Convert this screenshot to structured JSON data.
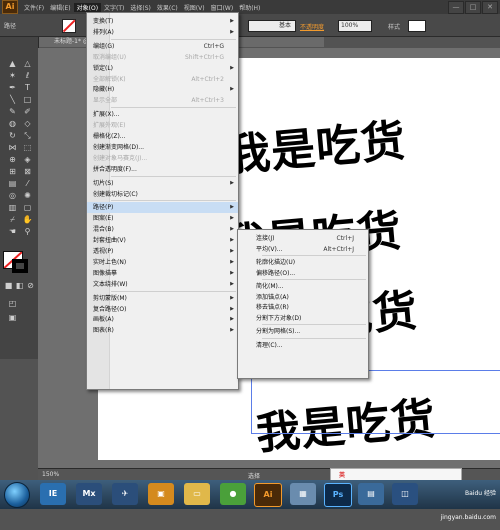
{
  "app": {
    "logo": "Ai"
  },
  "menubar": {
    "items": [
      "文件(F)",
      "编辑(E)",
      "对象(O)",
      "文字(T)",
      "选择(S)",
      "效果(C)",
      "视图(V)",
      "窗口(W)",
      "帮助(H)"
    ],
    "active_index": 2
  },
  "window_controls": [
    "—",
    "□",
    "✕"
  ],
  "controlbar": {
    "left_label": "路径",
    "stroke_style": "基本",
    "style_label": "不透明度",
    "opacity": "100%",
    "style_text": "样式"
  },
  "doc_tab": {
    "title": "未标题-1* @ 150% (RGB/预览)"
  },
  "artwork": {
    "lines": [
      "我是吃货",
      "我是吃货",
      "我是吃货",
      "我是吃货"
    ]
  },
  "object_menu": {
    "items": [
      {
        "label": "变换(T)",
        "submenu": true
      },
      {
        "label": "排列(A)",
        "submenu": true
      },
      {
        "sep": true
      },
      {
        "label": "编组(G)",
        "shortcut": "Ctrl+G"
      },
      {
        "label": "取消编组(U)",
        "shortcut": "Shift+Ctrl+G",
        "disabled": true
      },
      {
        "label": "锁定(L)",
        "submenu": true
      },
      {
        "label": "全部解锁(K)",
        "shortcut": "Alt+Ctrl+2",
        "disabled": true
      },
      {
        "label": "隐藏(H)",
        "submenu": true
      },
      {
        "label": "显示全部",
        "shortcut": "Alt+Ctrl+3",
        "disabled": true
      },
      {
        "sep": true
      },
      {
        "label": "扩展(X)..."
      },
      {
        "label": "扩展外观(E)",
        "disabled": true
      },
      {
        "label": "栅格化(Z)..."
      },
      {
        "label": "创建渐变网格(D)..."
      },
      {
        "label": "创建对象马赛克(J)...",
        "disabled": true
      },
      {
        "label": "拼合透明度(F)..."
      },
      {
        "sep": true
      },
      {
        "label": "切片(S)",
        "submenu": true
      },
      {
        "label": "创建裁切标记(C)"
      },
      {
        "sep": true
      },
      {
        "label": "路径(P)",
        "submenu": true,
        "highlighted": true
      },
      {
        "label": "图案(E)",
        "submenu": true
      },
      {
        "label": "混合(B)",
        "submenu": true
      },
      {
        "label": "封套扭曲(V)",
        "submenu": true
      },
      {
        "label": "透视(P)",
        "submenu": true
      },
      {
        "label": "实时上色(N)",
        "submenu": true
      },
      {
        "label": "图像描摹",
        "submenu": true
      },
      {
        "label": "文本绕排(W)",
        "submenu": true
      },
      {
        "sep": true
      },
      {
        "label": "剪切蒙版(M)",
        "submenu": true
      },
      {
        "label": "复合路径(O)",
        "submenu": true
      },
      {
        "label": "画板(A)",
        "submenu": true
      },
      {
        "label": "图表(R)",
        "submenu": true
      }
    ]
  },
  "path_menu": {
    "items": [
      {
        "label": "连接(J)",
        "shortcut": "Ctrl+J"
      },
      {
        "label": "平均(V)...",
        "shortcut": "Alt+Ctrl+J"
      },
      {
        "sep": true
      },
      {
        "label": "轮廓化描边(U)"
      },
      {
        "label": "偏移路径(O)..."
      },
      {
        "sep": true
      },
      {
        "label": "简化(M)..."
      },
      {
        "label": "添加锚点(A)"
      },
      {
        "label": "移去锚点(R)"
      },
      {
        "label": "分割下方对象(D)"
      },
      {
        "sep": true
      },
      {
        "label": "分割为网格(S)..."
      },
      {
        "sep": true
      },
      {
        "label": "清理(C)..."
      }
    ]
  },
  "statusbar": {
    "zoom": "150%",
    "tool": "选择"
  },
  "ime": {
    "label": "英"
  },
  "taskbar": {
    "apps": [
      "IE",
      "Mx",
      "Ai",
      "Ps"
    ],
    "watermark": "Baidu 经验 jingyan.baidu.com"
  },
  "colors": {
    "accent": "#f39b2e",
    "highlight": "#c8ddf4"
  }
}
